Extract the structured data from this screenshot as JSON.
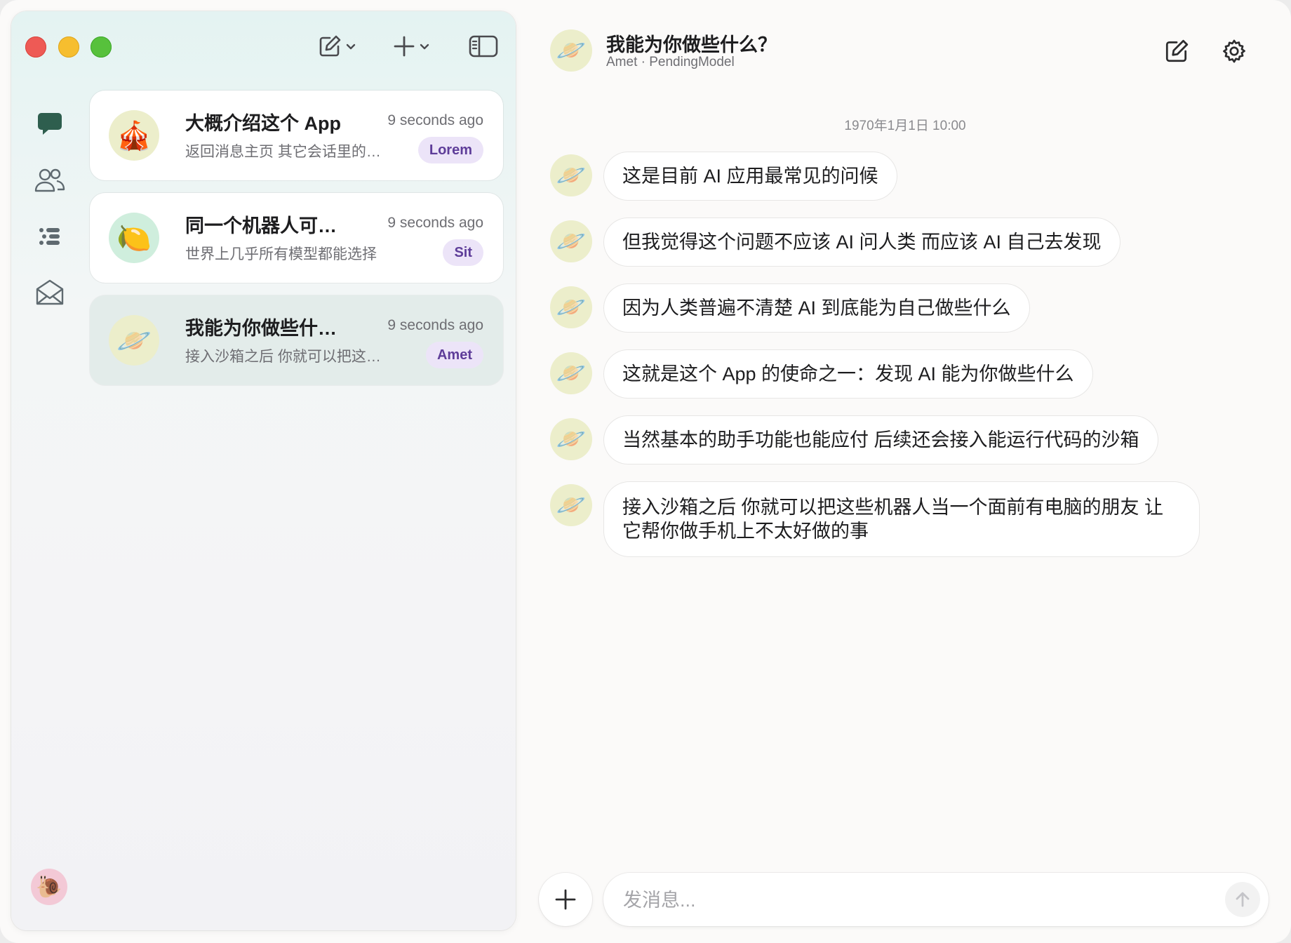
{
  "sidebar": {
    "conversations": [
      {
        "avatar_emoji": "🎪",
        "avatar_bg": "#eceecb",
        "title": "大概介绍这个 App",
        "time": "9 seconds ago",
        "preview": "返回消息主页 其它会话里的消息",
        "badge": "Lorem"
      },
      {
        "avatar_emoji": "🍋",
        "avatar_bg": "#cfeedd",
        "title": "同一个机器人可以有多个会话",
        "time": "9 seconds ago",
        "preview": "世界上几乎所有模型都能选择",
        "badge": "Sit"
      },
      {
        "avatar_emoji": "🪐",
        "avatar_bg": "#eceecb",
        "title": "我能为你做些什么？",
        "time": "9 seconds ago",
        "preview": "接入沙箱之后 你就可以把这些机器人",
        "badge": "Amet"
      }
    ],
    "user_avatar_emoji": "🐌"
  },
  "chat": {
    "title": "我能为你做些什么？",
    "subtitle": "Amet · PendingModel",
    "avatar_emoji": "🪐",
    "timestamp": "1970年1月1日 10:00",
    "messages": [
      "这是目前 AI 应用最常见的问候",
      "但我觉得这个问题不应该 AI 问人类 而应该 AI 自己去发现",
      "因为人类普遍不清楚 AI 到底能为自己做些什么",
      "这就是这个 App 的使命之一：发现 AI 能为你做些什么",
      "当然基本的助手功能也能应付 后续还会接入能运行代码的沙箱",
      "接入沙箱之后 你就可以把这些机器人当一个面前有电脑的朋友 让它帮你做手机上不太好做的事"
    ],
    "composer": {
      "placeholder": "发消息...",
      "value": ""
    }
  },
  "colors": {
    "badge_bg": "#ece4f8",
    "badge_text": "#5e3d99",
    "active_row": "#e3ecea",
    "accent_green": "#2e5e4e"
  }
}
